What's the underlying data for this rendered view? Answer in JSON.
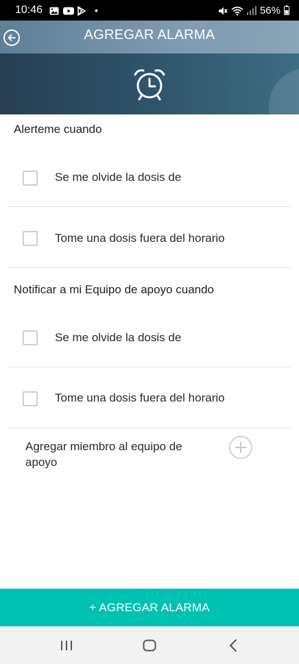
{
  "status_bar": {
    "time": "10:46",
    "dot": "•",
    "battery": "56%",
    "icons": [
      "gallery-icon",
      "youtube-icon",
      "play-store-icon",
      "mute-icon",
      "wifi-icon",
      "signal-icon",
      "battery-icon"
    ]
  },
  "header": {
    "title": "AGREGAR ALARMA",
    "back_icon": "back-arrow-circle-icon"
  },
  "banner": {
    "icon": "alarm-clock-icon"
  },
  "sections": {
    "alert_me": {
      "title": "Alerteme cuando",
      "options": [
        {
          "label": "Se me olvide la dosis de",
          "checked": false
        },
        {
          "label": "Tome una dosis fuera del horario",
          "checked": false
        }
      ]
    },
    "notify_team": {
      "title": "Notificar a mi Equipo de apoyo cuando",
      "options": [
        {
          "label": "Se me olvide la dosis de",
          "checked": false
        },
        {
          "label": "Tome una dosis fuera del horario",
          "checked": false
        }
      ]
    }
  },
  "add_member": {
    "label": "Agregar miembro al equipo de apoyo",
    "icon": "plus-circle-icon"
  },
  "primary_action": {
    "label": "+ AGREGAR ALARMA"
  },
  "nav_bar": {
    "icons": [
      "recent-apps-icon",
      "home-icon",
      "back-icon"
    ]
  },
  "colors": {
    "header": "#7f9bb1",
    "banner": "#2d5168",
    "accent": "#00c2b2",
    "nav_bar": "#f2f2f2"
  }
}
